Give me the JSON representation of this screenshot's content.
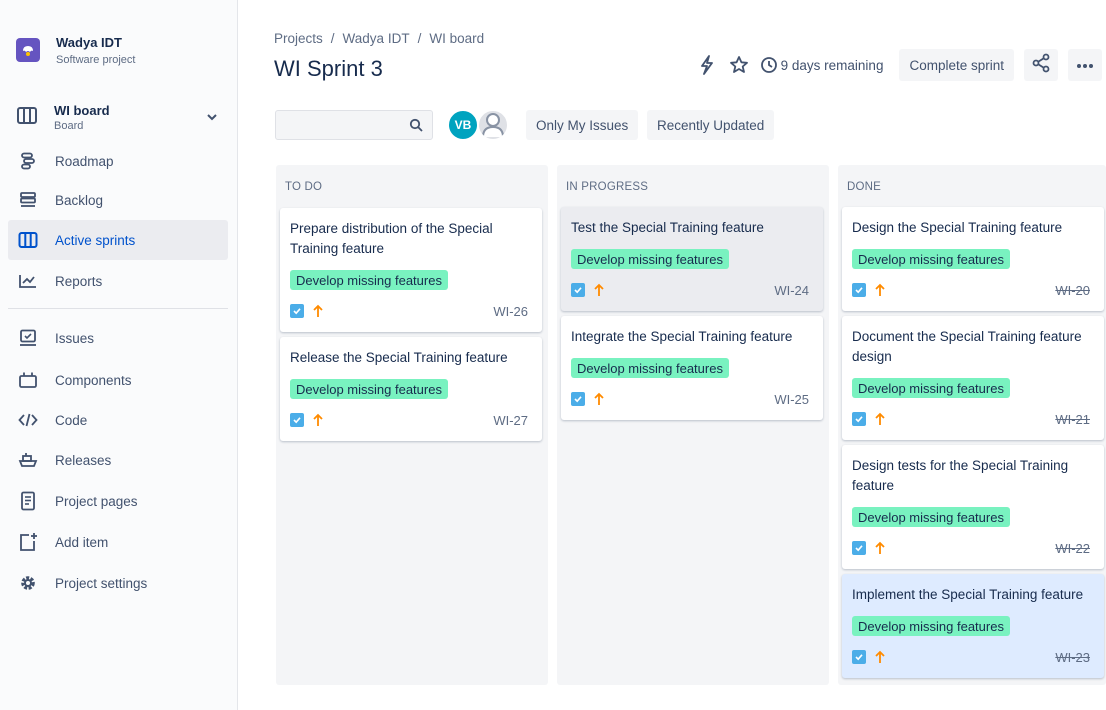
{
  "project": {
    "name": "Wadya IDT",
    "type": "Software project"
  },
  "board_selector": {
    "name": "WI board",
    "type": "Board"
  },
  "nav": [
    {
      "label": "Roadmap",
      "icon": "roadmap-icon",
      "active": false
    },
    {
      "label": "Backlog",
      "icon": "backlog-icon",
      "active": false
    },
    {
      "label": "Active sprints",
      "icon": "board-icon",
      "active": true
    },
    {
      "label": "Reports",
      "icon": "reports-icon",
      "active": false
    },
    {
      "label": "Issues",
      "icon": "issues-icon",
      "active": false
    },
    {
      "label": "Components",
      "icon": "components-icon",
      "active": false
    },
    {
      "label": "Code",
      "icon": "code-icon",
      "active": false
    },
    {
      "label": "Releases",
      "icon": "releases-icon",
      "active": false
    },
    {
      "label": "Project pages",
      "icon": "pages-icon",
      "active": false
    },
    {
      "label": "Add item",
      "icon": "add-item-icon",
      "active": false
    },
    {
      "label": "Project settings",
      "icon": "settings-icon",
      "active": false
    }
  ],
  "breadcrumbs": [
    "Projects",
    "Wadya IDT",
    "WI board"
  ],
  "page_title": "WI Sprint 3",
  "header": {
    "remaining": "9 days remaining",
    "complete_sprint": "Complete sprint"
  },
  "filters": {
    "search_placeholder": "",
    "avatar_initials": "VB",
    "only_my_issues": "Only My Issues",
    "recently_updated": "Recently Updated"
  },
  "columns": [
    {
      "title": "TO DO",
      "cards": [
        {
          "title": "Prepare distribution of the Special Training feature",
          "epic": "Develop missing features",
          "key": "WI-26",
          "done": false
        },
        {
          "title": "Release the Special Training feature",
          "epic": "Develop missing features",
          "key": "WI-27",
          "done": false
        }
      ]
    },
    {
      "title": "IN PROGRESS",
      "cards": [
        {
          "title": "Test the Special Training feature",
          "epic": "Develop missing features",
          "key": "WI-24",
          "done": false
        },
        {
          "title": "Integrate the Special Training feature",
          "epic": "Develop missing features",
          "key": "WI-25",
          "done": false
        }
      ]
    },
    {
      "title": "DONE",
      "cards": [
        {
          "title": "Design the Special Training feature",
          "epic": "Develop missing features",
          "key": "WI-20",
          "done": true
        },
        {
          "title": "Document the Special Training feature design",
          "epic": "Develop missing features",
          "key": "WI-21",
          "done": true
        },
        {
          "title": "Design tests for the Special Training feature",
          "epic": "Develop missing features",
          "key": "WI-22",
          "done": true
        },
        {
          "title": "Implement the Special Training feature",
          "epic": "Develop missing features",
          "key": "WI-23",
          "done": true
        }
      ]
    }
  ],
  "colors": {
    "accent": "#0052cc",
    "epic_label": "#79f2c0",
    "task_icon": "#4bade8",
    "priority_arrow": "#ff8b00"
  }
}
